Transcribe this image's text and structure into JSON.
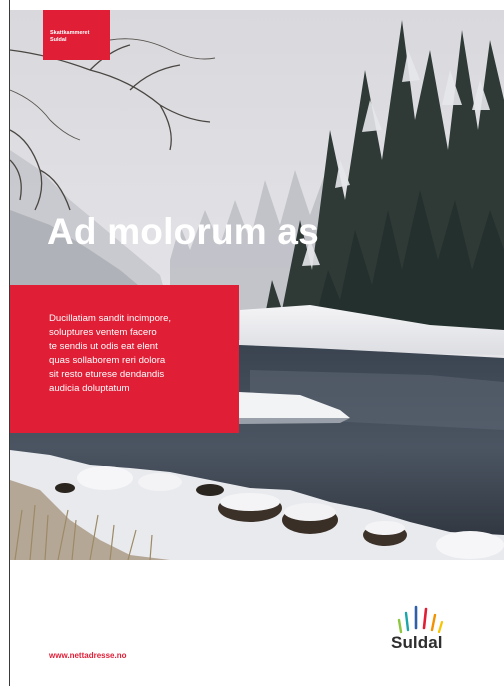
{
  "tag": {
    "line1": "Skattkammeret",
    "line2": "Suldal"
  },
  "headline": "Ad molorum as",
  "body_lines": [
    "Ducillatiam sandit incimpore,",
    "soluptures ventem facero",
    "te sendis ut odis eat elent",
    "quas sollaborem reri dolora",
    "sit resto eturese dendandis",
    "audicia doluptatum"
  ],
  "footer": {
    "url": "www.nettadresse.no"
  },
  "logo": {
    "wordmark": "Suldal",
    "icon": "colored-rays-logo",
    "ray_colors": [
      "#8dc63f",
      "#1aa5a8",
      "#2f5fa8",
      "#e01e36",
      "#f39200",
      "#f7c600"
    ]
  },
  "photo": {
    "subject": "snowy river landscape with forest"
  },
  "colors": {
    "brand_red": "#e01e36",
    "text_dark": "#2e2e2e"
  }
}
